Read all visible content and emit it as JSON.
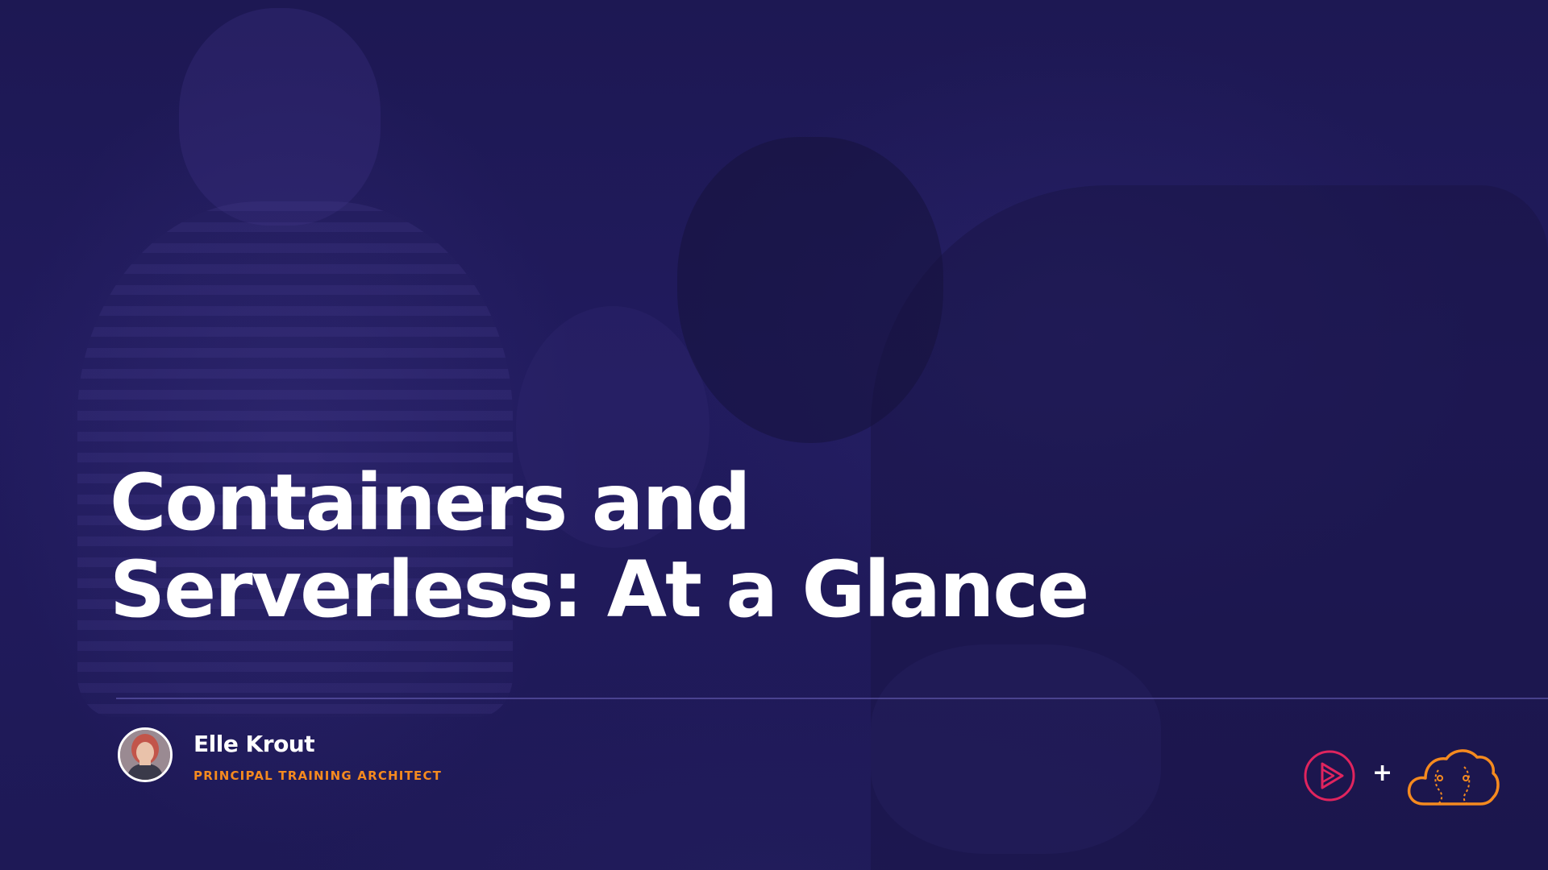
{
  "slide": {
    "title_line1": "Containers and",
    "title_line2": "Serverless: At a Glance"
  },
  "author": {
    "name": "Elle Krout",
    "role": "PRINCIPAL TRAINING ARCHITECT"
  },
  "logos": {
    "plus": "+",
    "left_icon": "pluralsight-play-icon",
    "right_icon": "acloudguru-cloud-icon"
  },
  "colors": {
    "background": "#1e1956",
    "accent_orange": "#f58a1f",
    "play_logo": "#e0245e",
    "title": "#ffffff"
  }
}
